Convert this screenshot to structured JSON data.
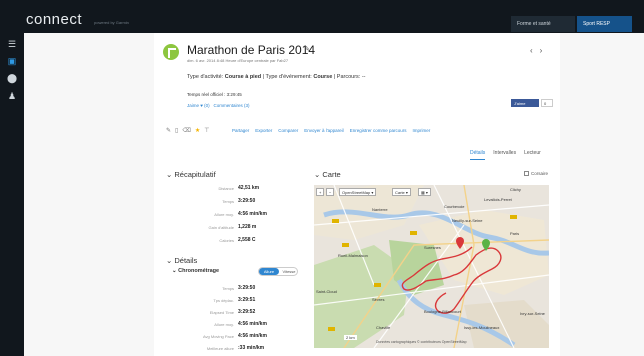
{
  "topbar": {
    "logo": "connect",
    "logo_sub": "powered by Garmin",
    "tab1": "Forme et santé",
    "tab2": "Sport RESP"
  },
  "sidebar": {
    "icons": [
      "menu-icon",
      "device-icon",
      "marker-icon",
      "user-icon"
    ]
  },
  "activity": {
    "title": "Marathon de Paris 2014",
    "meta": "dim. 6 avr. 2014 8:48 Heure d'Europe centrale par Fab27",
    "type_label": "Type d'activité: ",
    "type_value": "Course à pied",
    "event_label": " | Type d'événement: ",
    "event_value": "Course",
    "course_label": " | Parcours: --",
    "official_time": "Temps réel officiel : 3:29:45",
    "likes": "Jaime ♥ (0)",
    "comments": "Commentaires (3)",
    "fb_label": "J'aime",
    "fb_count": "0"
  },
  "actions": [
    "Partager",
    "Exporter",
    "Comparer",
    "Envoyer à l'appareil",
    "Enregistrer comme parcours",
    "Imprimer"
  ],
  "tabs": [
    "Détails",
    "Intervalles",
    "Lecteur"
  ],
  "recap": {
    "heading": "Récapitulatif",
    "rows": [
      {
        "label": "Distance",
        "value": "42,51 km"
      },
      {
        "label": "Temps",
        "value": "3:29:50"
      },
      {
        "label": "Allure moy.",
        "value": "4:56 min/km"
      },
      {
        "label": "Gain d'altitude",
        "value": "1,228 m"
      },
      {
        "label": "Calories",
        "value": "2,558 C"
      }
    ]
  },
  "details": {
    "heading": "Détails",
    "chrono_heading": "Chronométrage",
    "toggle_on": "Allure",
    "toggle_off": "Vitesse",
    "rows": [
      {
        "label": "Temps",
        "value": "3:29:50"
      },
      {
        "label": "Tps déplac.",
        "value": "3:29:51"
      },
      {
        "label": "Elapsed Time",
        "value": "3:29:52"
      },
      {
        "label": "Allure moy.",
        "value": "4:56 min/km"
      },
      {
        "label": "Avg Moving Pace",
        "value": "4:56 min/km"
      },
      {
        "label": "Meilleure allure",
        "value": ":33 min/km"
      }
    ]
  },
  "map": {
    "heading": "Carte",
    "checkbox": "Corsaire",
    "buttons": [
      "+",
      "−",
      "OpenStreetMap ▾",
      "Carte ▾",
      "▦ ▾"
    ],
    "places": [
      "Nanterre",
      "Courbevoie",
      "Levallois-Perret",
      "Clichy",
      "Neuilly-sur-Seine",
      "Paris",
      "Suresnes",
      "Rueil-Malmaison",
      "Boulogne-Billancourt",
      "Issy-les-Moulineaux",
      "Saint-Cloud",
      "Sèvres",
      "Chaville",
      "Ivry-sur-Seine"
    ],
    "scale": "2 km",
    "attribution": "Données cartographiques © contributeurs OpenStreetMap"
  }
}
